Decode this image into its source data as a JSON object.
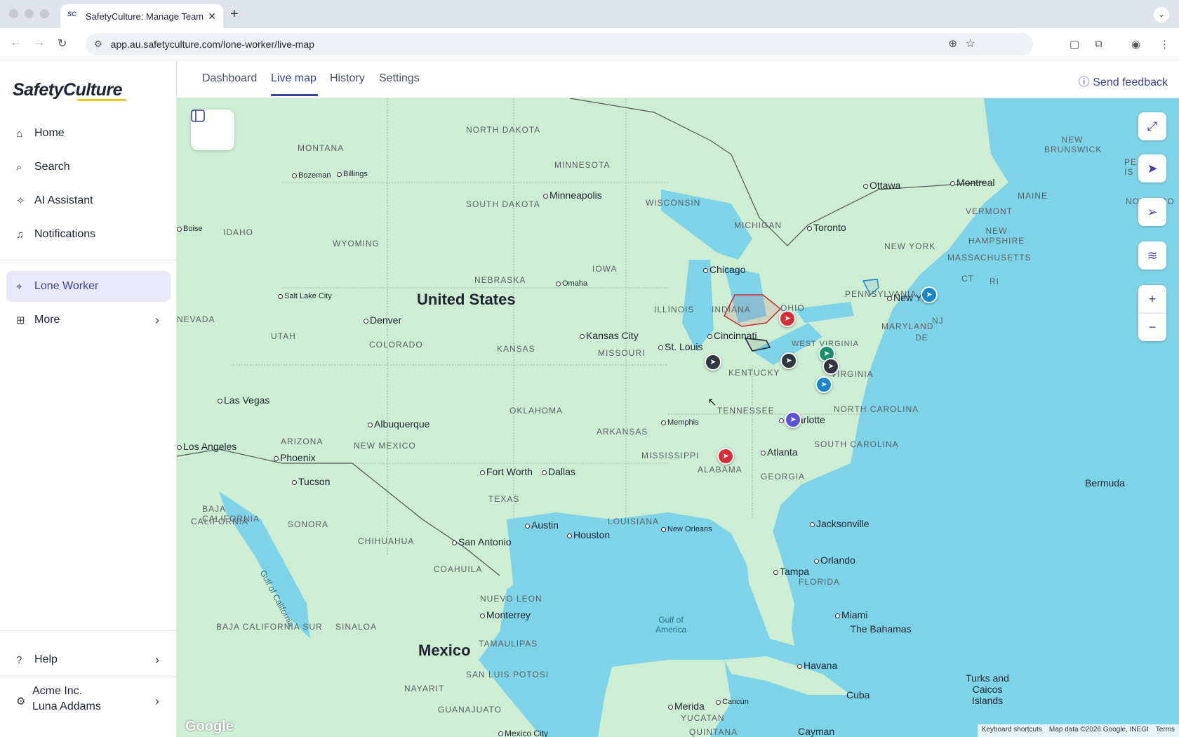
{
  "browser": {
    "tab_title": "SafetyCulture: Manage Teams",
    "favicon_text": "SC",
    "url": "app.au.safetyculture.com/lone-worker/live-map"
  },
  "sidebar": {
    "logo": "SafetyCulture",
    "items": [
      {
        "label": "Home",
        "icon": "home-icon"
      },
      {
        "label": "Search",
        "icon": "search-icon"
      },
      {
        "label": "AI Assistant",
        "icon": "sparkle-icon"
      },
      {
        "label": "Notifications",
        "icon": "bell-icon"
      },
      {
        "label": "Lone Worker",
        "icon": "lone-worker-icon"
      },
      {
        "label": "More",
        "icon": "grid-icon"
      }
    ],
    "help_label": "Help",
    "org_name": "Acme Inc.",
    "user_name": "Luna Addams"
  },
  "topnav": {
    "tabs": [
      "Dashboard",
      "Live map",
      "History",
      "Settings"
    ],
    "active_tab": "Live map",
    "feedback_label": "Send feedback"
  },
  "map": {
    "country_labels": [
      "United States",
      "Mexico"
    ],
    "state_labels": [
      "NORTH DAKOTA",
      "MONTANA",
      "MINNESOTA",
      "SOUTH DAKOTA",
      "WISCONSIN",
      "MICHIGAN",
      "IDAHO",
      "WYOMING",
      "IOWA",
      "NEBRASKA",
      "UTAH",
      "COLORADO",
      "KANSAS",
      "ILLINOIS",
      "INDIANA",
      "OHIO",
      "MISSOURI",
      "KENTUCKY",
      "WEST VIRGINIA",
      "VIRGINIA",
      "TENNESSEE",
      "NORTH CAROLINA",
      "ARIZONA",
      "NEW MEXICO",
      "OKLAHOMA",
      "ARKANSAS",
      "MISSISSIPPI",
      "ALABAMA",
      "GEORGIA",
      "SOUTH CAROLINA",
      "TEXAS",
      "LOUISIANA",
      "FLORIDA",
      "PENNSYLVANIA",
      "NEW YORK",
      "MARYLAND",
      "NJ",
      "DE",
      "CT",
      "RI",
      "MASSACHUSETTS",
      "NEW HAMPSHIRE",
      "VERMONT",
      "MAINE",
      "NEW BRUNSWICK",
      "NOVA SCO",
      "PE IS",
      "NEVADA",
      "CALIFORNIA",
      "BAJA CALIFORNIA",
      "SONORA",
      "CHIHUAHUA",
      "COAHUILA",
      "NUEVO LEON",
      "SINALOA",
      "BAJA CALIFORNIA SUR",
      "TAMAULIPAS",
      "SAN LUIS POTOSI",
      "NAYARIT",
      "GUANAJUATO",
      "YUCATAN",
      "QUINTANA"
    ],
    "cities": [
      "Bozeman",
      "Billings",
      "Boise",
      "Minneapolis",
      "Ottawa",
      "Montreal",
      "Toronto",
      "Chicago",
      "Omaha",
      "Salt Lake City",
      "Denver",
      "Kansas City",
      "St. Louis",
      "Cincinnati",
      "New York",
      "Las Vegas",
      "Albuquerque",
      "Memphis",
      "Charlotte",
      "Los Angeles",
      "Phoenix",
      "Tucson",
      "Fort Worth",
      "Dallas",
      "Atlanta",
      "Austin",
      "Houston",
      "New Orleans",
      "San Antonio",
      "Jacksonville",
      "Orlando",
      "Tampa",
      "Miami",
      "Monterrey",
      "Havana",
      "Merida",
      "Cancún",
      "Mexico City"
    ],
    "water_labels": [
      "Gulf of California",
      "Gulf of America"
    ],
    "sea_labels": [
      "Bermuda",
      "The Bahamas",
      "Cuba",
      "Turks and Caicos Islands",
      "Cayman"
    ],
    "markers": [
      {
        "color": "#d62d3a"
      },
      {
        "color": "#2f3640"
      },
      {
        "color": "#2f3640"
      },
      {
        "color": "#1a8f6b"
      },
      {
        "color": "#2f3640"
      },
      {
        "color": "#1a85c8"
      },
      {
        "color": "#1a85c8"
      },
      {
        "color": "#5a55d6"
      },
      {
        "color": "#d62d3a"
      }
    ],
    "google_logo": "Google",
    "attribution": [
      "Keyboard shortcuts",
      "Map data ©2026 Google, INEGI",
      "Terms"
    ]
  },
  "colors": {
    "accent": "#3a4299",
    "active_bg": "#e9e8fb",
    "water": "#7fd3e8",
    "land": "#cdeed3"
  }
}
